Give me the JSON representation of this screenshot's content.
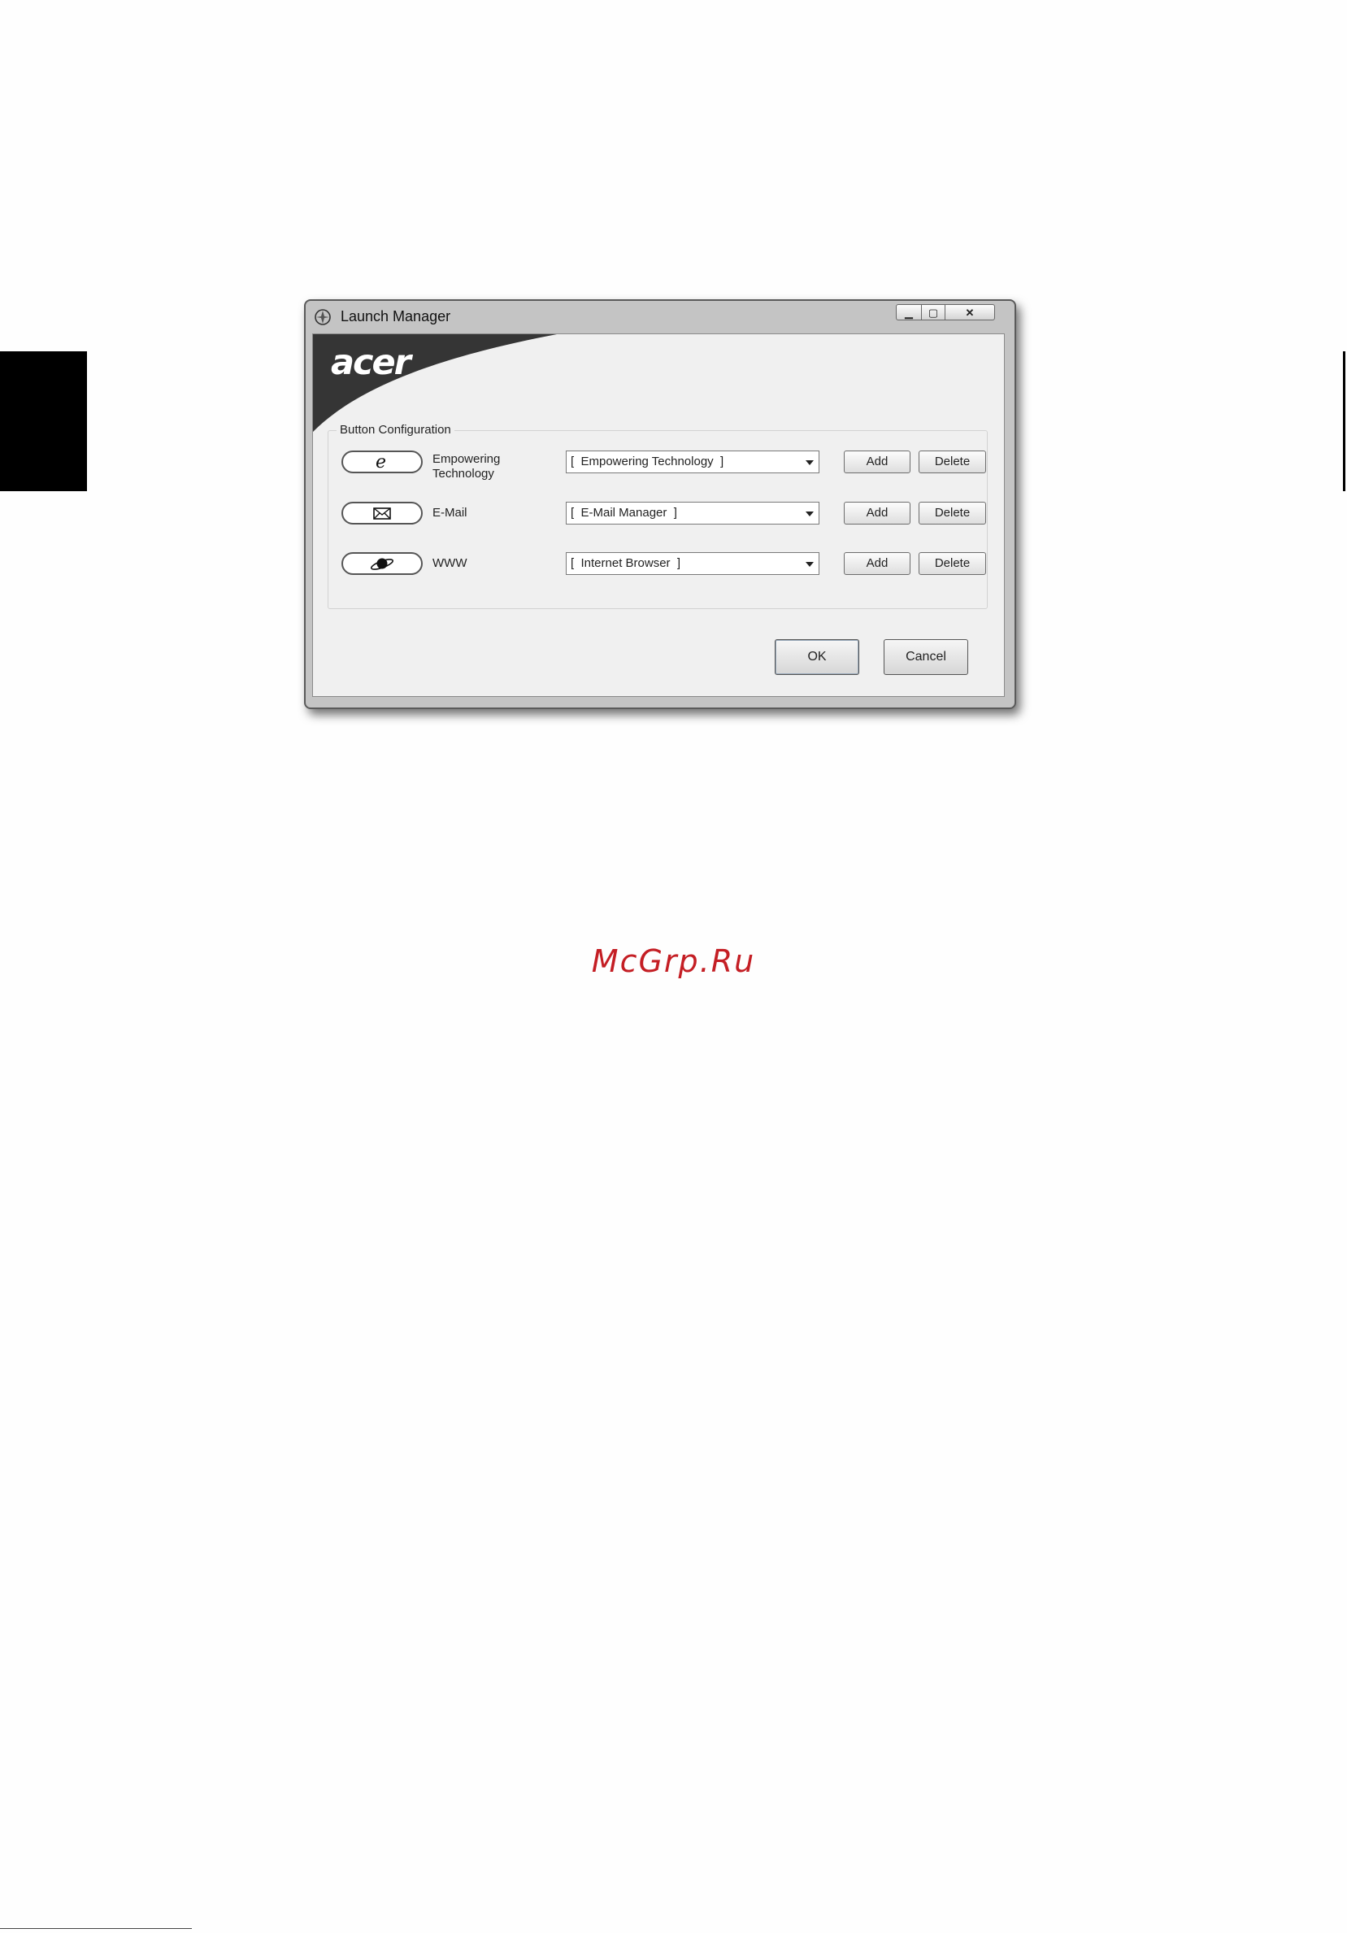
{
  "window": {
    "title": "Launch Manager",
    "controls": {
      "minimize": "▁",
      "maximize": "▢",
      "close": "✕"
    }
  },
  "banner": {
    "logo_text": "acer"
  },
  "config": {
    "group_title": "Button Configuration",
    "rows": [
      {
        "icon": "empowering-e-icon",
        "label_line1": "Empowering",
        "label_line2": "Technology",
        "selected": "[  Empowering Technology  ]",
        "add_label": "Add",
        "delete_label": "Delete"
      },
      {
        "icon": "envelope-icon",
        "label_line1": "E-Mail",
        "label_line2": "",
        "selected": "[  E-Mail Manager  ]",
        "add_label": "Add",
        "delete_label": "Delete"
      },
      {
        "icon": "planet-icon",
        "label_line1": "WWW",
        "label_line2": "",
        "selected": "[  Internet Browser  ]",
        "add_label": "Add",
        "delete_label": "Delete"
      }
    ]
  },
  "footer": {
    "ok_label": "OK",
    "cancel_label": "Cancel"
  },
  "watermark": "McGrp.Ru",
  "colors": {
    "banner_dark": "#353535",
    "banner_light": "#f0f0f0",
    "watermark": "#c41e24"
  }
}
